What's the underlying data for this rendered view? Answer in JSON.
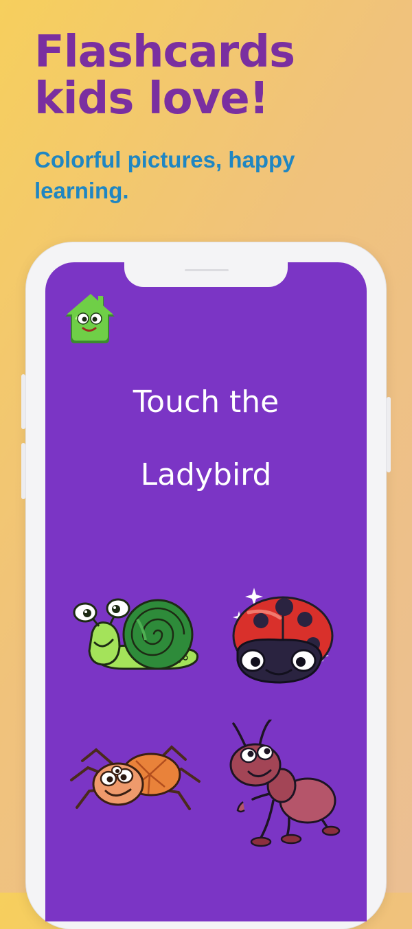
{
  "headline": {
    "line1": "Flashcards",
    "line2": "kids love!"
  },
  "subheadline": {
    "line1": "Colorful pictures, happy",
    "line2": "learning."
  },
  "app": {
    "prompt": {
      "line1": "Touch the",
      "line2": "Ladybird"
    },
    "home_icon": "house-icon",
    "cards": [
      {
        "animal": "snail-icon"
      },
      {
        "animal": "ladybird-icon"
      },
      {
        "animal": "spider-icon"
      },
      {
        "animal": "ant-icon"
      }
    ]
  },
  "colors": {
    "headline": "#7a2fa0",
    "subheadline": "#1f86c2",
    "screen": "#7b35c5",
    "background_start": "#f6cf5d",
    "background_end": "#ebbf93"
  }
}
